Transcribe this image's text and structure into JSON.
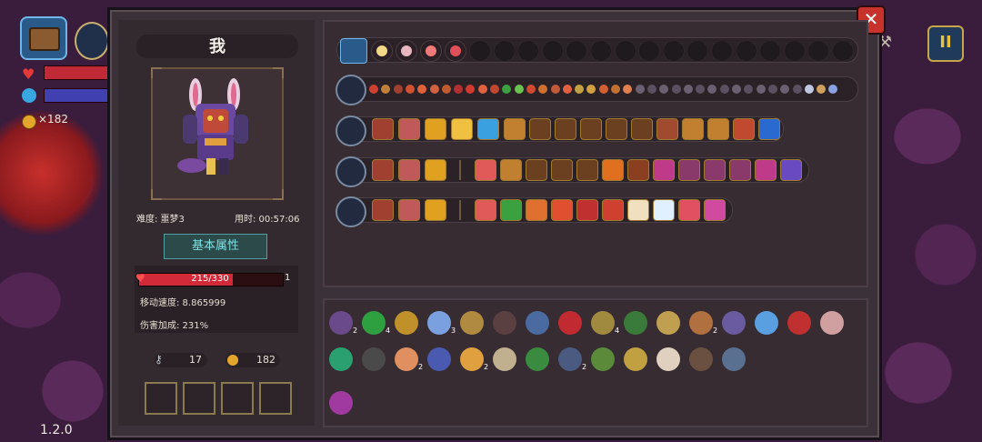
{
  "hud": {
    "coins": "×182",
    "version": "1.2.0",
    "pause_label": "II"
  },
  "close_label": "✕",
  "character": {
    "name": "我",
    "difficulty": "难度: 噩梦3",
    "time": "用时: 00:57:06",
    "attr_button": "基本属性",
    "hp": "215/330",
    "hp_fraction": 0.65,
    "hp_extra": "1",
    "move_speed": "移动速度: 8.865999",
    "damage_bonus": "伤害加成: 231%",
    "keys": "17",
    "gold": "182"
  },
  "colors": {
    "hp": "#d22a38",
    "accent_gold": "#e3a62a",
    "attr_text": "#7ee0e0"
  },
  "rows": {
    "equip_icons": [
      "#f2d98a",
      "#e8b6c0",
      "#f07a7a",
      "#e0505a",
      "#f06a40"
    ],
    "equip_empty": 16,
    "buff_colors": [
      "#d04030",
      "#c0803a",
      "#a04030",
      "#d05030",
      "#e0603a",
      "#d06040",
      "#c05a30",
      "#b03030",
      "#d03a30",
      "#e06040",
      "#c04830",
      "#3aa040",
      "#6ac050",
      "#d04a30",
      "#d07030",
      "#c05a3a",
      "#e06040",
      "#c0a040",
      "#d0a040",
      "#d06030",
      "#c07030",
      "#e08050",
      "#6a6070",
      "#5a5060",
      "#6a6070",
      "#5a5060",
      "#6a6070",
      "#5a5060",
      "#6a6070",
      "#5a5060",
      "#6a6070",
      "#5a5060",
      "#6a6070",
      "#5a5060",
      "#6a6070",
      "#5a5060",
      "#c0c8e0",
      "#d0a060",
      "#8aa0e0"
    ]
  },
  "inventory": {
    "row1": [
      {
        "color": "#6a4a8a",
        "count": "2"
      },
      {
        "color": "#2ea040",
        "count": "4"
      },
      {
        "color": "#c0902a",
        "count": ""
      },
      {
        "color": "#7aa0e0",
        "count": "3"
      },
      {
        "color": "#b08a40",
        "count": ""
      },
      {
        "color": "#5a4040",
        "count": ""
      },
      {
        "color": "#4a6aa0",
        "count": ""
      },
      {
        "color": "#c02a30",
        "count": ""
      },
      {
        "color": "#a08a40",
        "count": "4"
      },
      {
        "color": "#3a7a3a",
        "count": ""
      },
      {
        "color": "#c0a050",
        "count": ""
      },
      {
        "color": "#b07040",
        "count": "2"
      },
      {
        "color": "#6a5aa0",
        "count": ""
      },
      {
        "color": "#5aa0e0",
        "count": ""
      },
      {
        "color": "#c03030",
        "count": ""
      },
      {
        "color": "#d0a0a0",
        "count": ""
      }
    ],
    "row2": [
      {
        "color": "#2aa070",
        "count": ""
      },
      {
        "color": "#4a4a4a",
        "count": ""
      },
      {
        "color": "#e09060",
        "count": "2"
      },
      {
        "color": "#4a5ab0",
        "count": ""
      },
      {
        "color": "#e0a040",
        "count": "2"
      },
      {
        "color": "#c0b090",
        "count": ""
      },
      {
        "color": "#3a8a40",
        "count": ""
      },
      {
        "color": "#4a5a80",
        "count": "2"
      },
      {
        "color": "#5a8a3a",
        "count": ""
      },
      {
        "color": "#c0a040",
        "count": ""
      },
      {
        "color": "#e0d0c0",
        "count": ""
      },
      {
        "color": "#6a5040",
        "count": ""
      },
      {
        "color": "#5a7090",
        "count": ""
      }
    ],
    "row3": [
      {
        "color": "#a03aa0",
        "count": ""
      }
    ]
  }
}
